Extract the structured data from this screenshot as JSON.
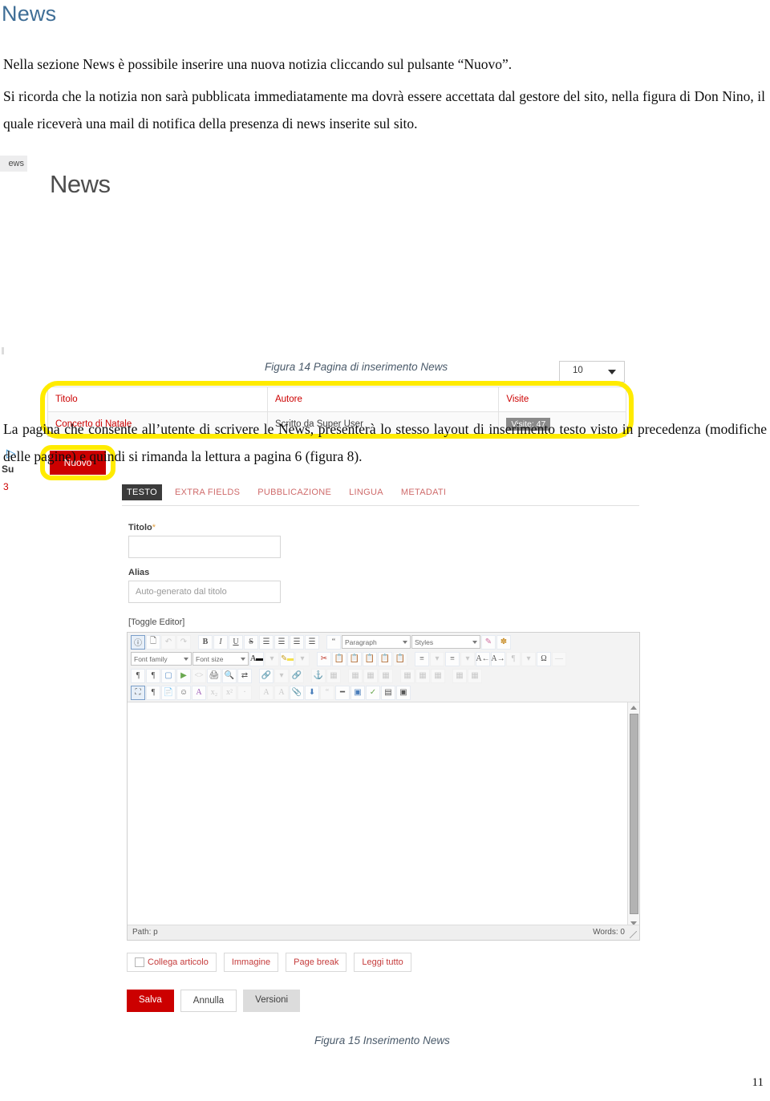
{
  "document": {
    "heading": "News",
    "paragraphs": [
      "Nella sezione News è possibile inserire una nuova notizia cliccando sul pulsante “Nuovo”.",
      "Si ricorda che la notizia non sarà pubblicata immediatamente ma dovrà essere accettata dal gestore del sito, nella figura di Don Nino, il quale riceverà una mail di notifica della presenza di news inserite sul sito.",
      "La pagina che consente all’utente di scrivere le News, presenterà lo stesso layout di inserimento testo visto in precedenza (modifiche delle pagine) e quindi si rimanda la lettura a pagina 6 (figura 8)."
    ],
    "captions": {
      "figure_14": "Figura 14 Pagina di inserimento News",
      "figure_15": "Figura 15 Inserimento News"
    },
    "page_number": "11"
  },
  "figure14": {
    "left_tab_fragment": "ews",
    "title": "News",
    "list_limit": {
      "value": "10",
      "caret_icon": "chevron-down-icon"
    },
    "table": {
      "headers": [
        "Titolo",
        "Autore",
        "Visite"
      ],
      "rows": [
        {
          "titolo": "Concerto di Natale",
          "autore": "Scritto da Super User",
          "visite": "Visite: 47"
        }
      ]
    },
    "new_button": "Nuovo",
    "left_fragments": {
      "arrow_icon": "▷",
      "su_label": "Su",
      "count": "3"
    },
    "highlight_color": "#ffeb00",
    "accent_color": "#cc0000"
  },
  "figure15": {
    "tabs": [
      {
        "label": "TESTO",
        "active": true
      },
      {
        "label": "EXTRA FIELDS",
        "active": false
      },
      {
        "label": "PUBBLICAZIONE",
        "active": false
      },
      {
        "label": "LINGUA",
        "active": false
      },
      {
        "label": "METADATI",
        "active": false
      }
    ],
    "fields": {
      "titolo_label": "Titolo",
      "titolo_required_mark": "*",
      "titolo_value": "",
      "alias_label": "Alias",
      "alias_placeholder": "Auto-generato dal titolo"
    },
    "toggle_editor": "[Toggle Editor]",
    "toolbar": {
      "row1": {
        "buttons": [
          "info-icon",
          "new-document-icon",
          "undo-icon",
          "redo-icon",
          "bold-icon",
          "italic-icon",
          "underline-icon",
          "strikethrough-icon",
          "align-left-icon",
          "align-center-icon",
          "align-right-icon",
          "align-justify-icon",
          "blockquote-icon"
        ],
        "paragraph_select": "Paragraph",
        "styles_select": "Styles",
        "extra": [
          "edit-css-icon",
          "clear-formatting-icon"
        ]
      },
      "row2": {
        "font_family_select": "Font family",
        "font_size_select": "Font size",
        "buttons": [
          "text-color-icon",
          "background-color-icon",
          "cut-icon",
          "copy-icon",
          "paste-icon",
          "paste-text-icon",
          "paste-word-icon",
          "paste-plain-icon",
          "numbered-list-icon",
          "bullet-list-icon",
          "decrease-indent-icon",
          "increase-indent-icon",
          "special-character-icon",
          "horizontal-rule-icon"
        ]
      },
      "row3": {
        "buttons": [
          "ltr-icon",
          "rtl-icon",
          "image-icon",
          "media-icon",
          "code-icon",
          "print-icon",
          "search-icon",
          "replace-icon",
          "link-icon",
          "unlink-icon",
          "anchor-icon",
          "table-icon",
          "row-props-icon",
          "cell-props-icon",
          "insert-row-before-icon",
          "insert-row-after-icon",
          "delete-row-icon",
          "insert-col-before-icon",
          "insert-col-after-icon",
          "delete-col-icon",
          "split-cell-icon",
          "merge-cell-icon"
        ]
      },
      "row4": {
        "buttons": [
          "fullscreen-icon",
          "show-blocks-icon",
          "template-icon",
          "emoticon-icon",
          "spellcheck-icon",
          "subscript-icon",
          "superscript-icon",
          "nonbreaking-icon",
          "visualchars-icon",
          "visualaid-icon",
          "attachment-icon",
          "download-icon",
          "cite-icon",
          "abbr-icon",
          "acronym-icon",
          "delete-icon",
          "insert-icon",
          "pagebreak-icon",
          "readmore-icon"
        ]
      }
    },
    "editor_body": {
      "content": "",
      "scrollbar": "vertical-scrollbar"
    },
    "status_bar": {
      "path_label": "Path:",
      "path_value": "p",
      "words": "Words: 0"
    },
    "extra_buttons": [
      {
        "label": "Collega articolo",
        "icon": "link-article-icon"
      },
      {
        "label": "Immagine",
        "icon": null
      },
      {
        "label": "Page break",
        "icon": null
      },
      {
        "label": "Leggi tutto",
        "icon": null
      }
    ],
    "action_buttons": [
      {
        "label": "Salva",
        "style": "primary"
      },
      {
        "label": "Annulla",
        "style": "default"
      },
      {
        "label": "Versioni",
        "style": "muted"
      }
    ]
  }
}
